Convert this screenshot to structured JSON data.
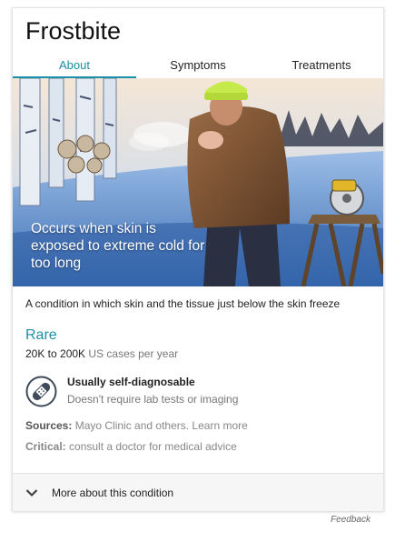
{
  "title": "Frostbite",
  "tabs": [
    {
      "label": "About",
      "active": true
    },
    {
      "label": "Symptoms",
      "active": false
    },
    {
      "label": "Treatments",
      "active": false
    }
  ],
  "hero": {
    "caption": "Occurs when skin is exposed to extreme cold for too long"
  },
  "description": "A condition in which skin and the tissue just below the skin freeze",
  "rarity": {
    "label": "Rare",
    "cases_range": "20K to 200K",
    "cases_suffix": "US cases per year"
  },
  "diagnosis": {
    "icon": "bandage-icon",
    "title": "Usually self-diagnosable",
    "subtitle": "Doesn't require lab tests or imaging"
  },
  "sources": {
    "label": "Sources:",
    "text": "Mayo Clinic and others. Learn more"
  },
  "critical": {
    "label": "Critical:",
    "text": "consult a doctor for medical advice"
  },
  "more": {
    "label": "More about this condition",
    "icon": "chevron-down-icon"
  },
  "feedback": "Feedback",
  "colors": {
    "accent": "#1a8fa7"
  }
}
